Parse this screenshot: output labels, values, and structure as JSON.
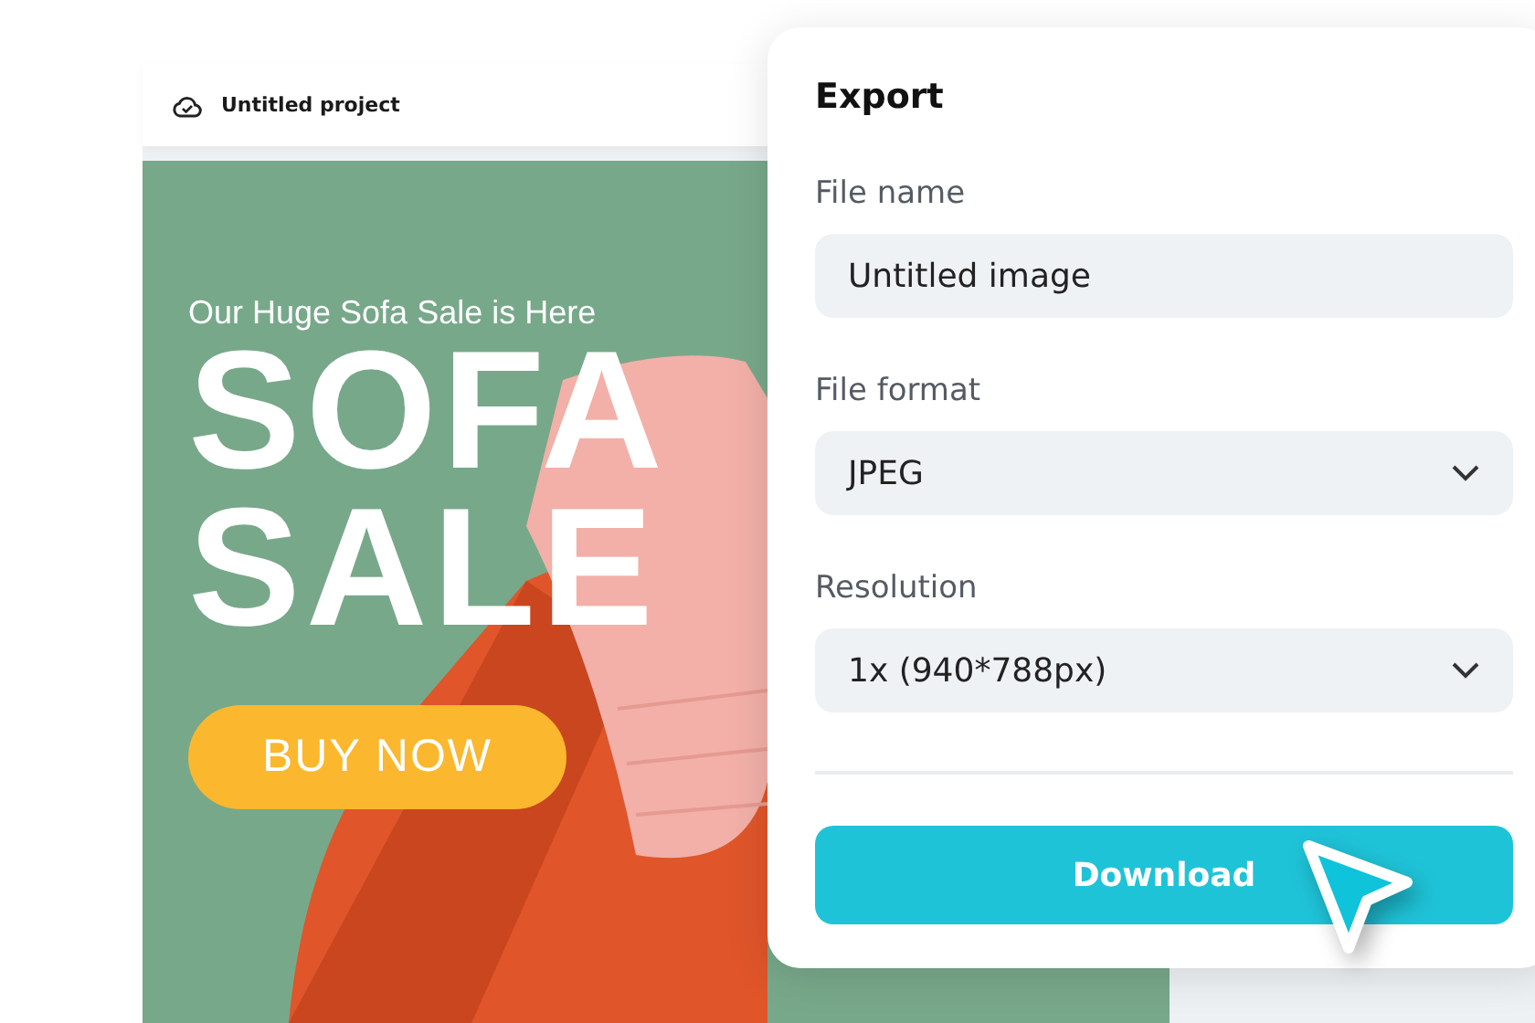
{
  "editor": {
    "project_title": "Untitled project"
  },
  "design": {
    "subtitle": "Our Huge Sofa Sale is Here",
    "headline": [
      "SOFA",
      "SALE"
    ],
    "cta": "BUY NOW"
  },
  "export": {
    "title": "Export",
    "fields": [
      {
        "kind": "text",
        "label": "File name",
        "value": "Untitled image"
      },
      {
        "kind": "select",
        "label": "File format",
        "value": "JPEG"
      },
      {
        "kind": "select",
        "label": "Resolution",
        "value": "1x (940*788px)"
      }
    ],
    "button": "Download"
  }
}
